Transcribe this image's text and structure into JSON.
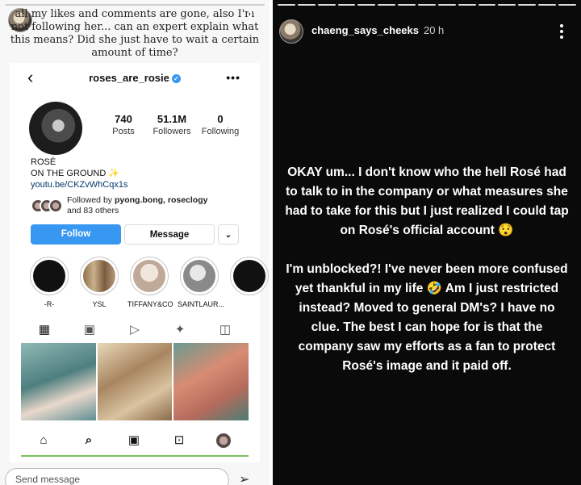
{
  "left_story": {
    "username": "chaeng_says_cheeks",
    "caption": "all my likes and comments are gone, also I'm not following her... can an expert explain what this means? Did she just have to wait a certain amount of time?",
    "send_placeholder": "Send message",
    "icon_send": "paper-plane-icon",
    "icon_more": "three-dots-vertical-icon"
  },
  "instagram": {
    "back_icon": "chevron-left-icon",
    "handle": "roses_are_rosie",
    "verified_icon": "verified-badge-icon",
    "more_icon": "more-horizontal-icon",
    "stats": [
      {
        "value": "740",
        "label": "Posts"
      },
      {
        "value": "51.1M",
        "label": "Followers"
      },
      {
        "value": "0",
        "label": "Following"
      }
    ],
    "bio": {
      "name": "ROSÉ",
      "line": "ON THE GROUND",
      "sparkle": "✨",
      "link": "youtu.be/CKZvWhCqx1s"
    },
    "followed_by": {
      "prefix": "Followed by ",
      "names": "pyong.bong, roseclogy",
      "suffix": "and 83 others"
    },
    "buttons": {
      "follow": "Follow",
      "message": "Message",
      "dropdown": "⌄"
    },
    "highlights": [
      {
        "label": "-R-",
        "color": "#111111"
      },
      {
        "label": "YSL",
        "color": "#b49a7a"
      },
      {
        "label": "TIFFANY&CO",
        "color": "#d9cbbf"
      },
      {
        "label": "SAINTLAUR...",
        "color": "#9a9a9a"
      },
      {
        "label": "",
        "color": "#111111"
      }
    ],
    "tabs": [
      "grid-icon",
      "reels-icon",
      "play-icon",
      "sparkles-icon",
      "tagged-icon"
    ],
    "grid_colors": [
      "#5f8f93",
      "#c2a382",
      "#c97f6e"
    ],
    "nav": [
      "home-icon",
      "search-icon",
      "reels-icon",
      "shop-icon",
      "profile-avatar-icon"
    ]
  },
  "right_story": {
    "username": "chaeng_says_cheeks",
    "time": "20 h",
    "icon_more": "three-dots-vertical-icon",
    "paragraph1": "OKAY um... I don't know who the hell Rosé had to talk to in the company or what measures she had to take for this but I just realized I could tap on Rosé's official account 😯",
    "paragraph2": "I'm unblocked?! I've never been more confused yet thankful in my life 🤣 Am I just restricted instead? Moved to general DM's? I have no clue. The best I can hope for is that the company saw my efforts as a fan to protect Rosé's image and it paid off."
  }
}
